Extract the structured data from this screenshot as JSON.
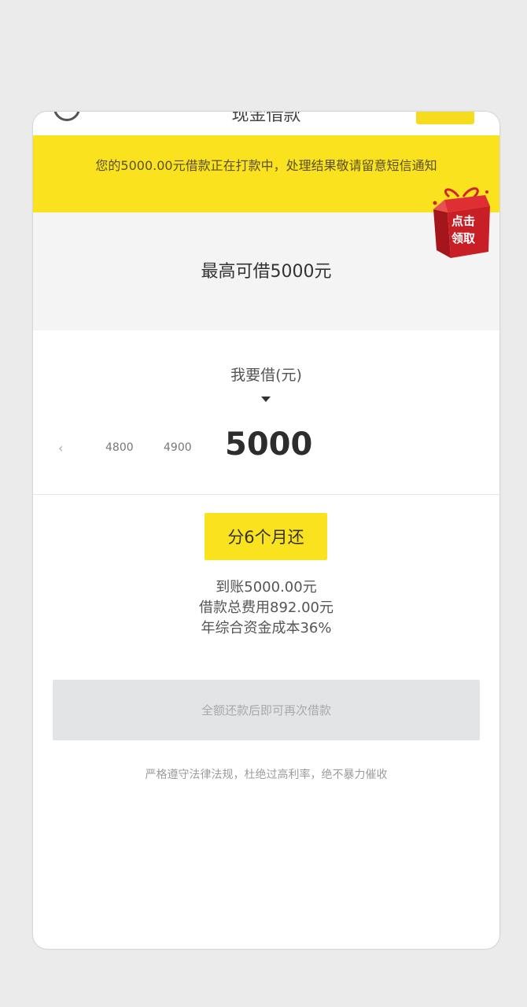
{
  "header": {
    "title": "现金借款"
  },
  "notice": {
    "text": "您的5000.00元借款正在打款中，处理结果敬请留意短信通知"
  },
  "limit": {
    "text": "最高可借5000元"
  },
  "promo": {
    "text": "点击领取"
  },
  "amount": {
    "label": "我要借(元)",
    "options": [
      "4800",
      "4900"
    ],
    "selected": "5000"
  },
  "installment": {
    "button_label": "分6个月还",
    "details": [
      "到账5000.00元",
      "借款总费用892.00元",
      "年综合资金成本36%"
    ]
  },
  "repay": {
    "button_label": "全额还款后即可再次借款"
  },
  "footer": {
    "note": "严格遵守法律法规，杜绝过高利率，绝不暴力催收"
  },
  "colors": {
    "accent": "#fae21f",
    "promo_red": "#d4232a"
  }
}
